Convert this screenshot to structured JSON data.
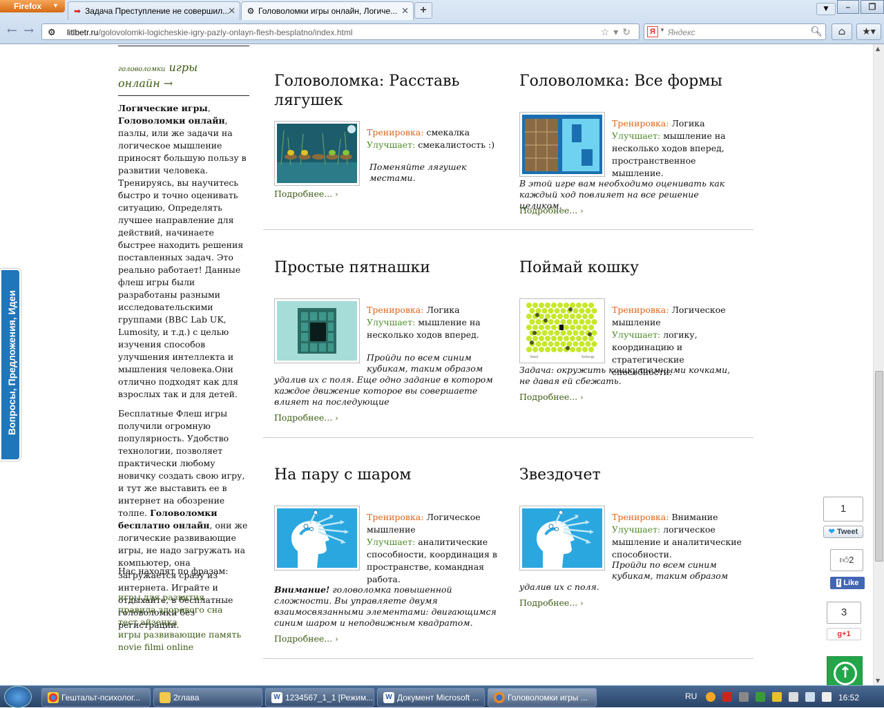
{
  "browser": {
    "menu_button": "Firefox",
    "tabs": [
      {
        "label": "Задача Преступление не совершил..."
      },
      {
        "label": "Головоломки игры онлайн, Логиче..."
      }
    ],
    "url_domain": "litlbetr.ru",
    "url_path": "/golovolomki-logicheskie-igry-pazly-onlayn-flesh-besplatno/index.html",
    "search_placeholder": "Яндекс",
    "search_engine_badge": "Я"
  },
  "sidebar": {
    "category_small": "головоломки",
    "category_big": "игры",
    "category_line2": "онлайн →",
    "para1": [
      {
        "t": "Логические игры",
        "b": true
      },
      {
        "t": ", ",
        "b": false
      },
      {
        "t": "Головоломки онлайн",
        "b": true
      },
      {
        "t": ", пазлы, или же задачи на логическое мышление приносят большую пользу в развитии человека. Тренируясь, вы научитесь быстро и точно оценивать ситуацию, Определять лучшее направление для действий, начинаете быстрее находить решения поставленных задач. Это реально работает! Данные флеш игры были разработаны разными исследовательскими группами (BBC Lab UK, Lumosity, и т.д.) с целью изучения способов улучшения интеллекта и мышления человека.Они отлично подходят как для взрослых так и для детей.",
        "b": false
      }
    ],
    "para2": [
      {
        "t": "Бесплатные Флеш игры получили огромную популярность. Удобство технологии, позволяет практически любому новичку создать свою игру, и тут же выставить ее в интернет на обозрение толпе. ",
        "b": false
      },
      {
        "t": "Головоломки бесплатно онлайн",
        "b": true
      },
      {
        "t": ", они же логические развивающие игры, не надо загружать на компьютер, она загружается сразу из интернета. Играйте и отдыхайте, в бесплатные головоломки без регистрации.",
        "b": false
      }
    ],
    "phrases_title": "Нас находят по фразам:",
    "phrases": [
      "игры для развития",
      "правила здорового сна",
      "тест айзенка",
      "игры развивающие память",
      "novie filmi online"
    ]
  },
  "feedback_tab": "Вопросы, Предложения, Идеи",
  "labels": {
    "training": "Тренировка:",
    "improves": "Улучшает:",
    "more": "Подробнее...",
    "chevron": "›"
  },
  "games": [
    {
      "title": "Головоломка: Расставь лягушек",
      "training": "смекалка",
      "improves": "смекалистость :)",
      "desc_inline": "Поменяйте лягушек местами.",
      "desc": ""
    },
    {
      "title": "Головоломка: Все формы",
      "training": "Логика",
      "improves": "мышление на несколько ходов вперед, пространственное мышление.",
      "desc_inline": "",
      "desc": "В этой игре вам необходимо оценивать как каждый ход повлияет на все решение целиком."
    },
    {
      "title": "Простые пятнашки",
      "training": "Логика",
      "improves": "мышление на несколько ходов вперед.",
      "desc_inline": "Пройди по всем синим кубикам, таким образом",
      "desc": "удалив их с поля. Еще одно задание в котором каждое движение которое вы совершаете влияет на последующие"
    },
    {
      "title": "Поймай кошку",
      "training": "Логическое мышление",
      "improves": "логику, координацию и стратегические способности.",
      "desc_inline": "",
      "desc": "Задача: окружить кошку темными кочками, не давая ей сбежать."
    },
    {
      "title": "На пару с шаром",
      "training": "Логическое мышление",
      "improves": "аналитические способности, координация в пространстве, командная работа.",
      "desc_inline": "",
      "desc_bold": "Внимание!",
      "desc": " головоломка повышенной сложности. Вы управляете двумя взаимосвязанными элементами: двигающимся синим шаром и неподвижным квадратом."
    },
    {
      "title": "Звездочет",
      "training": "Внимание",
      "improves": "логическое мышление и аналитические способности.",
      "desc_inline": "Пройди по всем синим кубикам, таким образом",
      "desc": "удалив их с поля."
    }
  ],
  "social": {
    "tweet_count": "1",
    "tweet_label": "Tweet",
    "like_count": "2",
    "like_label": "Like",
    "gplus_count": "3",
    "gplus_label": "g+1"
  },
  "taskbar": {
    "items": [
      {
        "label": "Гештальт-психолог...",
        "icon": "chrome-icon"
      },
      {
        "label": "2глава",
        "icon": "folder-icon"
      },
      {
        "label": "1234567_1_1 [Режим...",
        "icon": "word-icon"
      },
      {
        "label": "Документ Microsoft ...",
        "icon": "word-icon"
      },
      {
        "label": "Головоломки игры ...",
        "icon": "firefox-icon"
      }
    ],
    "lang": "RU",
    "time": "16:52"
  },
  "colors": {
    "accent_green": "#3c5a14",
    "training_orange": "#d9641a",
    "improves_green": "#4f8a2c",
    "feedback_blue": "#1f76b8"
  }
}
